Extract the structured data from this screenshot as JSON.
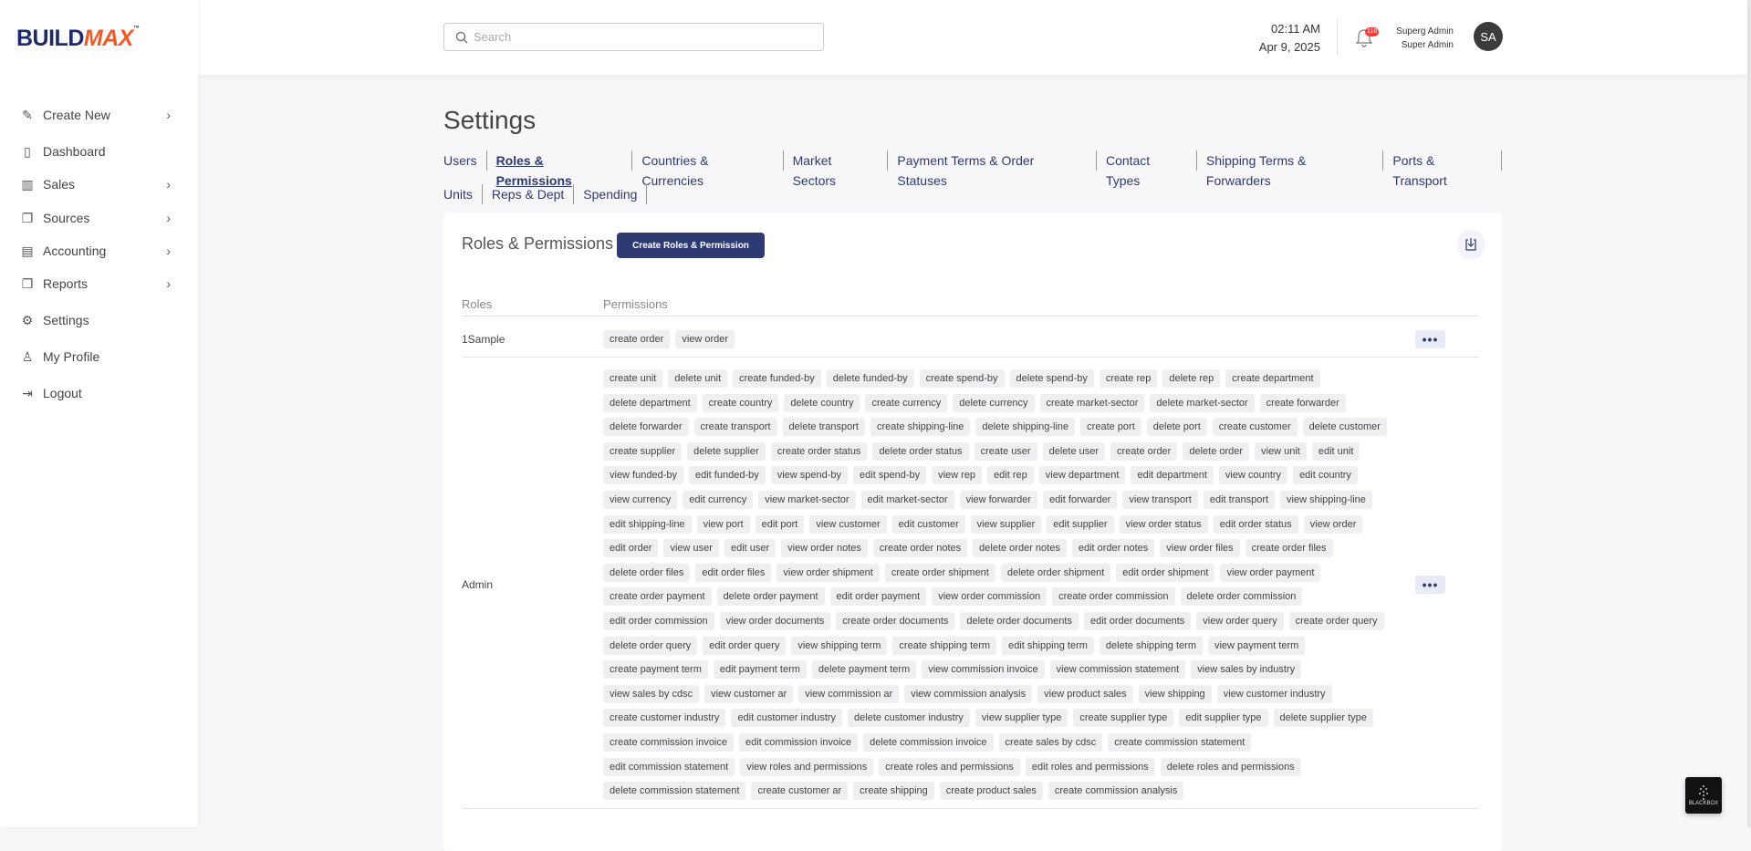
{
  "brand": {
    "logo_a": "BUILD",
    "logo_b": "MAX",
    "tm": "™",
    "accent": "#f05a28",
    "primary": "#2e3b73"
  },
  "sidebar": {
    "items": [
      {
        "label": "Create New",
        "icon": "edit-icon",
        "chevron": true
      },
      {
        "label": "Dashboard",
        "icon": "clipboard-icon",
        "chevron": false
      },
      {
        "label": "Sales",
        "icon": "bar-chart-icon",
        "chevron": true
      },
      {
        "label": "Sources",
        "icon": "copy-icon",
        "chevron": true
      },
      {
        "label": "Accounting",
        "icon": "calculator-icon",
        "chevron": true
      },
      {
        "label": "Reports",
        "icon": "copy-icon",
        "chevron": true
      },
      {
        "label": "Settings",
        "icon": "gear-icon",
        "chevron": false
      },
      {
        "label": "My Profile",
        "icon": "user-icon",
        "chevron": false
      },
      {
        "label": "Logout",
        "icon": "logout-icon",
        "chevron": false
      }
    ]
  },
  "header": {
    "search_placeholder": "Search",
    "time": "02:11 AM",
    "date": "Apr 9, 2025",
    "notification_count": "118",
    "user_name": "Superg Admin",
    "user_role": "Super Admin",
    "avatar_initials": "SA"
  },
  "page": {
    "title": "Settings",
    "tabs_row1": [
      "Users",
      "Roles & Permissions",
      "Countries & Currencies",
      "Market Sectors",
      "Payment Terms & Order Statuses",
      "Contact Types",
      "Shipping Terms & Forwarders",
      "Ports & Transport"
    ],
    "tabs_row2": [
      "Units",
      "Reps & Dept",
      "Spending"
    ],
    "active_tab": "Roles & Permissions"
  },
  "card": {
    "title": "Roles & Permissions",
    "create_button": "Create Roles & Permission",
    "col_roles": "Roles",
    "col_permissions": "Permissions",
    "more_label": "•••",
    "roles": [
      {
        "name": "1Sample",
        "permissions": [
          "create order",
          "view order"
        ]
      },
      {
        "name": "Admin",
        "permissions": [
          "create unit",
          "delete unit",
          "create funded-by",
          "delete funded-by",
          "create spend-by",
          "delete spend-by",
          "create rep",
          "delete rep",
          "create department",
          "delete department",
          "create country",
          "delete country",
          "create currency",
          "delete currency",
          "create market-sector",
          "delete market-sector",
          "create forwarder",
          "delete forwarder",
          "create transport",
          "delete transport",
          "create shipping-line",
          "delete shipping-line",
          "create port",
          "delete port",
          "create customer",
          "delete customer",
          "create supplier",
          "delete supplier",
          "create order status",
          "delete order status",
          "create user",
          "delete user",
          "create order",
          "delete order",
          "view unit",
          "edit unit",
          "view funded-by",
          "edit funded-by",
          "view spend-by",
          "edit spend-by",
          "view rep",
          "edit rep",
          "view department",
          "edit department",
          "view country",
          "edit country",
          "view currency",
          "edit currency",
          "view market-sector",
          "edit market-sector",
          "view forwarder",
          "edit forwarder",
          "view transport",
          "edit transport",
          "view shipping-line",
          "edit shipping-line",
          "view port",
          "edit port",
          "view customer",
          "edit customer",
          "view supplier",
          "edit supplier",
          "view order status",
          "edit order status",
          "view order",
          "edit order",
          "view user",
          "edit user",
          "view order notes",
          "create order notes",
          "delete order notes",
          "edit order notes",
          "view order files",
          "create order files",
          "delete order files",
          "edit order files",
          "view order shipment",
          "create order shipment",
          "delete order shipment",
          "edit order shipment",
          "view order payment",
          "create order payment",
          "delete order payment",
          "edit order payment",
          "view order commission",
          "create order commission",
          "delete order commission",
          "edit order commission",
          "view order documents",
          "create order documents",
          "delete order documents",
          "edit order documents",
          "view order query",
          "create order query",
          "delete order query",
          "edit order query",
          "view shipping term",
          "create shipping term",
          "edit shipping term",
          "delete shipping term",
          "view payment term",
          "create payment term",
          "edit payment term",
          "delete payment term",
          "view commission invoice",
          "view commission statement",
          "view sales by industry",
          "view sales by cdsc",
          "view customer ar",
          "view commission ar",
          "view commission analysis",
          "view product sales",
          "view shipping",
          "view customer industry",
          "create customer industry",
          "edit customer industry",
          "delete customer industry",
          "view supplier type",
          "create supplier type",
          "edit supplier type",
          "delete supplier type",
          "create commission invoice",
          "edit commission invoice",
          "delete commission invoice",
          "create sales by cdsc",
          "create commission statement",
          "edit commission statement",
          "view roles and permissions",
          "create roles and permissions",
          "edit roles and permissions",
          "delete roles and permissions",
          "delete commission statement",
          "create customer ar",
          "create shipping",
          "create product sales",
          "create commission analysis"
        ]
      }
    ]
  },
  "widget": {
    "label": "BLACKBOX"
  }
}
